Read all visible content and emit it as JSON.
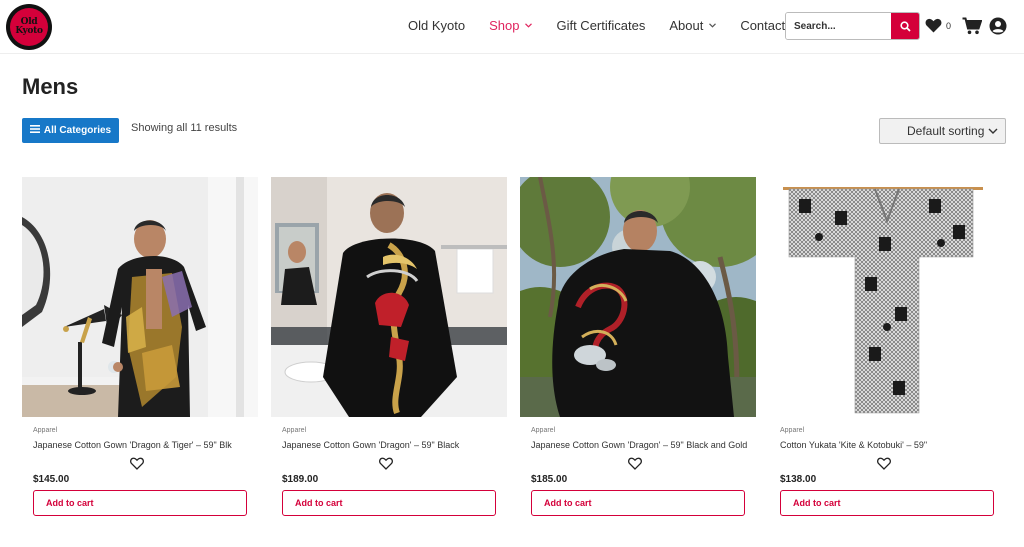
{
  "header": {
    "logo_line1": "Old",
    "logo_line2": "Kyoto",
    "nav": [
      {
        "label": "Old Kyoto"
      },
      {
        "label": "Shop"
      },
      {
        "label": "Gift Certificates"
      },
      {
        "label": "About"
      },
      {
        "label": "Contact Us"
      }
    ],
    "search_placeholder": "Search...",
    "wishlist_count": "0",
    "accent_color": "#d4003a",
    "active_nav_color": "#e0245e"
  },
  "main": {
    "title": "Mens",
    "categories_button": "All Categories",
    "result_count": "Showing all 11 results",
    "sorting": "Default sorting"
  },
  "products": [
    {
      "category": "Apparel",
      "name": "Japanese Cotton Gown 'Dragon & Tiger' – 59\" Blk",
      "price": "$145.00",
      "add_label": "Add to cart"
    },
    {
      "category": "Apparel",
      "name": "Japanese Cotton Gown 'Dragon' – 59\" Black",
      "price": "$189.00",
      "add_label": "Add to cart"
    },
    {
      "category": "Apparel",
      "name": "Japanese Cotton Gown 'Dragon' – 59\" Black and Gold",
      "price": "$185.00",
      "add_label": "Add to cart"
    },
    {
      "category": "Apparel",
      "name": "Cotton Yukata 'Kite & Kotobuki' – 59\"",
      "price": "$138.00",
      "add_label": "Add to cart"
    }
  ]
}
